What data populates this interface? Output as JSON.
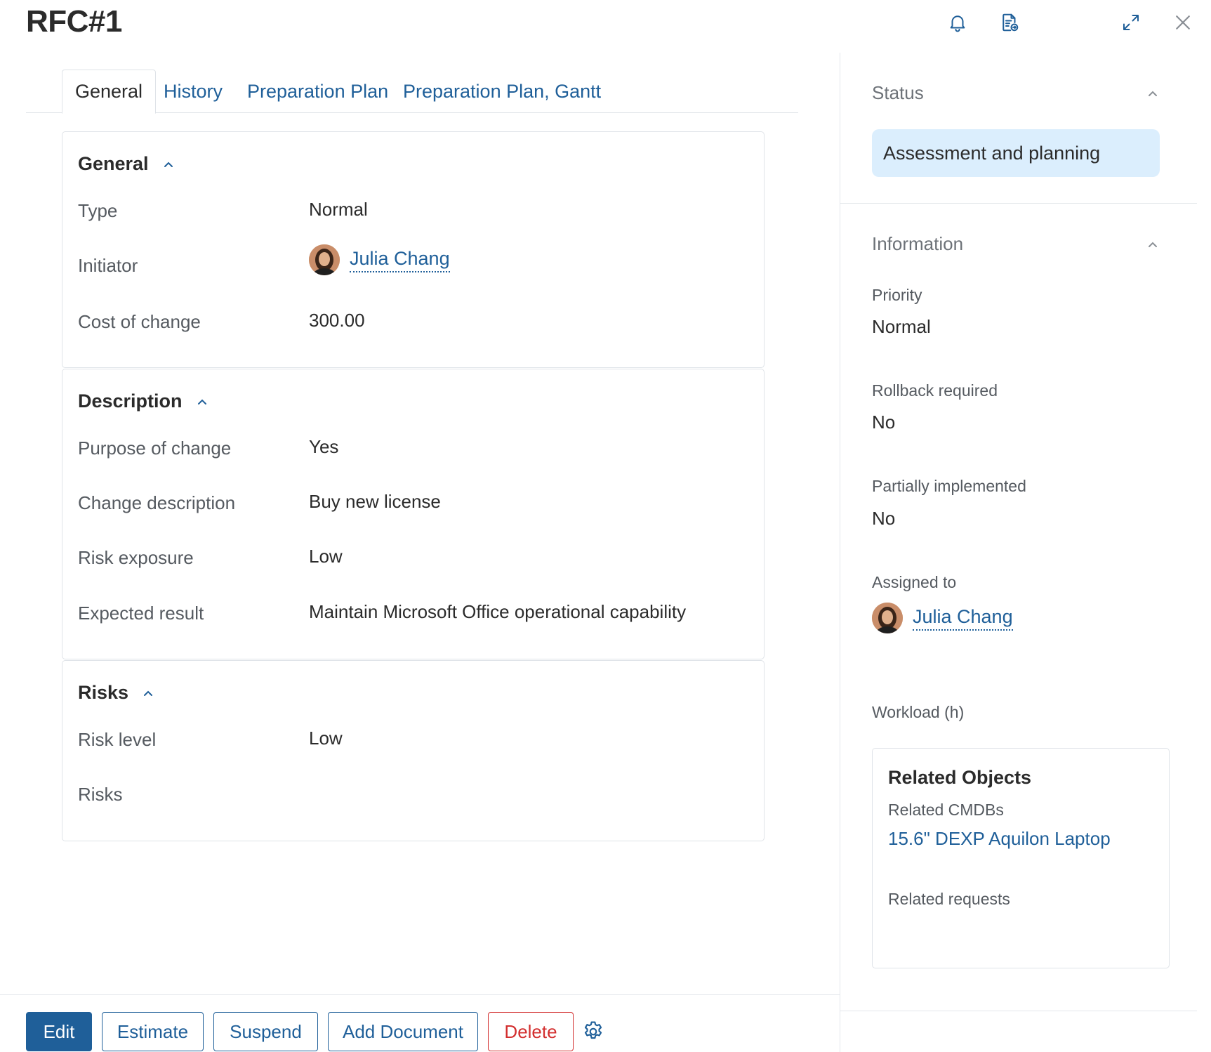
{
  "header": {
    "title": "RFC#1",
    "icons": [
      "bell-icon",
      "document-export-icon",
      "expand-icon",
      "close-icon"
    ]
  },
  "tabs": [
    {
      "label": "General",
      "active": true
    },
    {
      "label": "History",
      "active": false
    },
    {
      "label": "Preparation Plan",
      "active": false
    },
    {
      "label": "Preparation Plan, Gantt",
      "active": false
    }
  ],
  "general": {
    "heading": "General",
    "type_label": "Type",
    "type_value": "Normal",
    "initiator_label": "Initiator",
    "initiator_name": "Julia Chang",
    "cost_label": "Cost of change",
    "cost_value": "300.00"
  },
  "description": {
    "heading": "Description",
    "purpose_label": "Purpose of change",
    "purpose_value": "Yes",
    "change_desc_label": "Change description",
    "change_desc_value": "Buy new license",
    "risk_exposure_label": "Risk exposure",
    "risk_exposure_value": "Low",
    "expected_label": "Expected result",
    "expected_value": "Maintain Microsoft Office operational capability"
  },
  "risks": {
    "heading": "Risks",
    "risk_level_label": "Risk level",
    "risk_level_value": "Low",
    "risks_label": "Risks"
  },
  "sidebar": {
    "status_heading": "Status",
    "status_value": "Assessment and planning",
    "info_heading": "Information",
    "priority_label": "Priority",
    "priority_value": "Normal",
    "rollback_label": "Rollback required",
    "rollback_value": "No",
    "partial_label": "Partially implemented",
    "partial_value": "No",
    "assigned_label": "Assigned to",
    "assigned_name": "Julia Chang",
    "workload_label": "Workload (h)",
    "related": {
      "title": "Related Objects",
      "cmdb_label": "Related CMDBs",
      "cmdb_link": "15.6\" DEXP Aquilon Laptop",
      "requests_label": "Related requests"
    }
  },
  "footer": {
    "edit": "Edit",
    "estimate": "Estimate",
    "suspend": "Suspend",
    "add_document": "Add Document",
    "delete": "Delete"
  },
  "colors": {
    "accent": "#1f5f99",
    "danger": "#d32f2f",
    "status_bg": "#dbeefd",
    "border": "#dfe3e8"
  }
}
